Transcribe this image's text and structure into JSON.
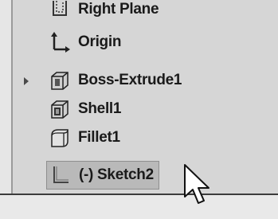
{
  "feature_tree": {
    "items": [
      {
        "label": "Right Plane",
        "icon": "plane-icon"
      },
      {
        "label": "Origin",
        "icon": "origin-icon"
      },
      {
        "label": "Boss-Extrude1",
        "icon": "extrude-icon",
        "expandable": true
      },
      {
        "label": "Shell1",
        "icon": "shell-icon"
      },
      {
        "label": "Fillet1",
        "icon": "fillet-icon"
      },
      {
        "label": "(-) Sketch2",
        "icon": "sketch-icon",
        "selected": true
      }
    ]
  },
  "colors": {
    "background": "#d6d6d6",
    "selection": "#b9b9b9",
    "text": "#1a1a1a"
  }
}
